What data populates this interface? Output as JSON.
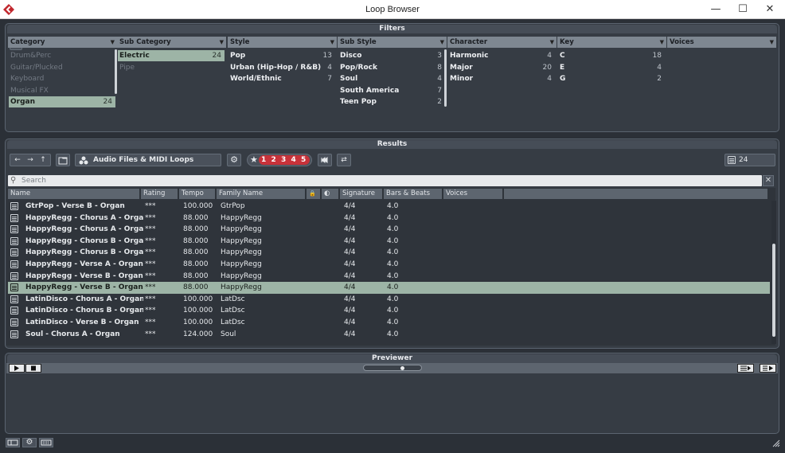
{
  "window": {
    "title": "Loop Browser",
    "minimize": "—",
    "maximize": "☐",
    "close": "✕"
  },
  "filters": {
    "header": "Filters",
    "columns": [
      {
        "title": "Category",
        "items": [
          {
            "label": "Drum&Perc",
            "count": "",
            "state": "dim"
          },
          {
            "label": "Guitar/Plucked",
            "count": "",
            "state": "dim"
          },
          {
            "label": "Keyboard",
            "count": "",
            "state": "dim"
          },
          {
            "label": "Musical FX",
            "count": "",
            "state": "dim"
          },
          {
            "label": "Organ",
            "count": "24",
            "state": "sel"
          }
        ]
      },
      {
        "title": "Sub Category",
        "items": [
          {
            "label": "Electric",
            "count": "24",
            "state": "sel"
          },
          {
            "label": "Pipe",
            "count": "",
            "state": "dim"
          }
        ]
      },
      {
        "title": "Style",
        "items": [
          {
            "label": "Pop",
            "count": "13",
            "state": ""
          },
          {
            "label": "Urban (Hip-Hop / R&B)",
            "count": "4",
            "state": ""
          },
          {
            "label": "World/Ethnic",
            "count": "7",
            "state": ""
          }
        ]
      },
      {
        "title": "Sub Style",
        "items": [
          {
            "label": "Disco",
            "count": "3",
            "state": ""
          },
          {
            "label": "Pop/Rock",
            "count": "8",
            "state": ""
          },
          {
            "label": "Soul",
            "count": "4",
            "state": ""
          },
          {
            "label": "South America",
            "count": "7",
            "state": ""
          },
          {
            "label": "Teen Pop",
            "count": "2",
            "state": ""
          }
        ]
      },
      {
        "title": "Character",
        "items": [
          {
            "label": "Harmonic",
            "count": "4",
            "state": ""
          },
          {
            "label": "Major",
            "count": "20",
            "state": ""
          },
          {
            "label": "Minor",
            "count": "4",
            "state": ""
          }
        ]
      },
      {
        "title": "Key",
        "items": [
          {
            "label": "C",
            "count": "18",
            "state": ""
          },
          {
            "label": "E",
            "count": "4",
            "state": ""
          },
          {
            "label": "G",
            "count": "2",
            "state": ""
          }
        ]
      },
      {
        "title": "Voices",
        "items": []
      }
    ]
  },
  "results": {
    "header": "Results",
    "source_label": "Audio Files & MIDI Loops",
    "ratings": [
      "1",
      "2",
      "3",
      "4",
      "5"
    ],
    "count": "24",
    "search_placeholder": "Search",
    "columns": [
      "Name",
      "Rating",
      "Tempo",
      "Family Name",
      "",
      "",
      "Signature",
      "Bars & Beats",
      "Voices"
    ],
    "rows": [
      {
        "name": "GtrPop - Verse B - Organ",
        "rating": "***",
        "tempo": "100.000",
        "family": "GtrPop",
        "sig": "4/4",
        "bars": "4.0",
        "selected": false
      },
      {
        "name": "HappyRegg - Chorus A - Organ",
        "rating": "***",
        "tempo": "88.000",
        "family": "HappyRegg",
        "sig": "4/4",
        "bars": "4.0",
        "selected": false
      },
      {
        "name": "HappyRegg - Chorus A - OrganSeq",
        "rating": "***",
        "tempo": "88.000",
        "family": "HappyRegg",
        "sig": "4/4",
        "bars": "4.0",
        "selected": false
      },
      {
        "name": "HappyRegg - Chorus B - Organ",
        "rating": "***",
        "tempo": "88.000",
        "family": "HappyRegg",
        "sig": "4/4",
        "bars": "4.0",
        "selected": false
      },
      {
        "name": "HappyRegg - Chorus B - OrganSeq",
        "rating": "***",
        "tempo": "88.000",
        "family": "HappyRegg",
        "sig": "4/4",
        "bars": "4.0",
        "selected": false
      },
      {
        "name": "HappyRegg - Verse A - OrganSeq",
        "rating": "***",
        "tempo": "88.000",
        "family": "HappyRegg",
        "sig": "4/4",
        "bars": "4.0",
        "selected": false
      },
      {
        "name": "HappyRegg - Verse B - Organ",
        "rating": "***",
        "tempo": "88.000",
        "family": "HappyRegg",
        "sig": "4/4",
        "bars": "4.0",
        "selected": false
      },
      {
        "name": "HappyRegg - Verse B - OrganSeq",
        "rating": "***",
        "tempo": "88.000",
        "family": "HappyRegg",
        "sig": "4/4",
        "bars": "4.0",
        "selected": true
      },
      {
        "name": "LatinDisco - Chorus A - Organ",
        "rating": "***",
        "tempo": "100.000",
        "family": "LatDsc",
        "sig": "4/4",
        "bars": "4.0",
        "selected": false
      },
      {
        "name": "LatinDisco - Chorus B - Organ",
        "rating": "***",
        "tempo": "100.000",
        "family": "LatDsc",
        "sig": "4/4",
        "bars": "4.0",
        "selected": false
      },
      {
        "name": "LatinDisco - Verse B - Organ",
        "rating": "***",
        "tempo": "100.000",
        "family": "LatDsc",
        "sig": "4/4",
        "bars": "4.0",
        "selected": false
      },
      {
        "name": "Soul - Chorus A - Organ",
        "rating": "***",
        "tempo": "124.000",
        "family": "Soul",
        "sig": "4/4",
        "bars": "4.0",
        "selected": false
      }
    ]
  },
  "previewer": {
    "header": "Previewer"
  },
  "colors": {
    "selection": "#9db4a6",
    "rating_red": "#c8323a",
    "panel": "#363c44"
  }
}
